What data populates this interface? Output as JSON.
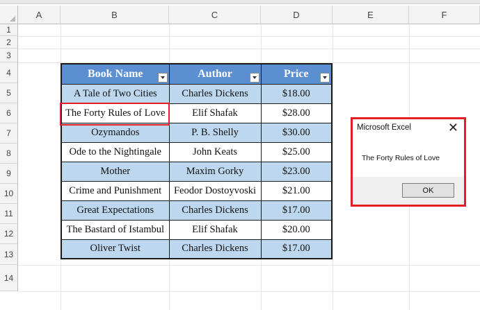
{
  "sheet": {
    "columns": [
      "A",
      "B",
      "C",
      "D",
      "E",
      "F"
    ],
    "rows": [
      "1",
      "2",
      "3",
      "4",
      "5",
      "6",
      "7",
      "8",
      "9",
      "10",
      "11",
      "12",
      "13",
      "14"
    ]
  },
  "table": {
    "headers": [
      "Book Name",
      "Author",
      "Price"
    ],
    "rows": [
      [
        "A Tale of Two Cities",
        "Charles Dickens",
        "$18.00"
      ],
      [
        "The Forty Rules of Love",
        "Elif Shafak",
        "$28.00"
      ],
      [
        "Ozymandos",
        "P. B. Shelly",
        "$30.00"
      ],
      [
        "Ode to the Nightingale",
        "John Keats",
        "$25.00"
      ],
      [
        "Mother",
        "Maxim Gorky",
        "$23.00"
      ],
      [
        "Crime and Punishment",
        "Feodor Dostoyvoski",
        "$21.00"
      ],
      [
        "Great Expectations",
        "Charles Dickens",
        "$17.00"
      ],
      [
        "The Bastard of Istambul",
        "Elif Shafak",
        "$20.00"
      ],
      [
        "Oliver Twist",
        "Charles Dickens",
        "$17.00"
      ]
    ],
    "header_color": "#5b8fd1",
    "band_color": "#bdd7ee"
  },
  "dialog": {
    "title": "Microsoft Excel",
    "message": "The Forty Rules of Love",
    "ok_label": "OK",
    "close_icon": "close-icon"
  },
  "highlight_color": "#e31e24"
}
